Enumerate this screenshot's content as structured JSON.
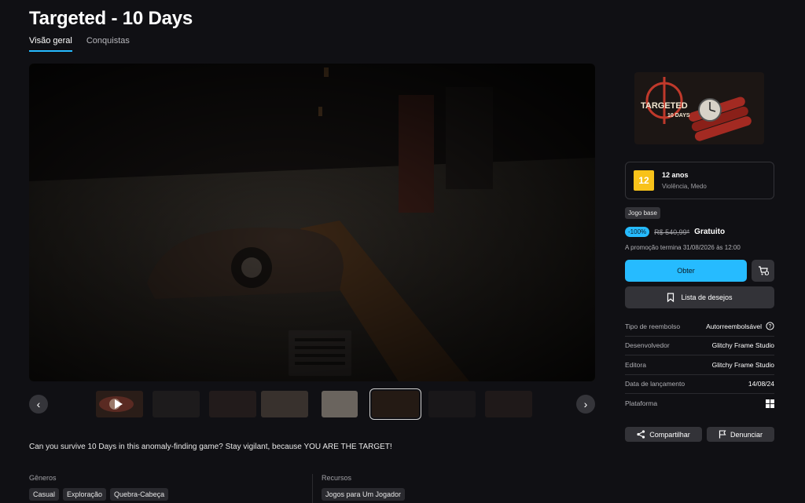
{
  "page": {
    "title": "Targeted - 10 Days"
  },
  "tabs": [
    {
      "label": "Visão geral"
    },
    {
      "label": "Conquistas"
    }
  ],
  "description": "Can you survive 10 Days in this anomaly-finding game? Stay vigilant, because YOU ARE THE TARGET!",
  "genres": {
    "label": "Gêneros",
    "items": [
      "Casual",
      "Exploração",
      "Quebra-Cabeça"
    ]
  },
  "features": {
    "label": "Recursos",
    "items": [
      "Jogos para Um Jogador"
    ]
  },
  "cover": {
    "title_line1": "TARGETED",
    "title_line2": "10 DAYS"
  },
  "rating": {
    "box": "12",
    "age": "12 anos",
    "descriptors": "Violência, Medo"
  },
  "badge": "Jogo base",
  "price": {
    "discount": "-100%",
    "original": "R$ 540,99*",
    "current": "Gratuito",
    "promo_end": "A promoção termina 31/08/2026 às 12:00"
  },
  "buttons": {
    "get": "Obter",
    "wishlist": "Lista de desejos",
    "share": "Compartilhar",
    "report": "Denunciar"
  },
  "info": [
    {
      "key": "Tipo de reembolso",
      "value": "Autorreembolsável"
    },
    {
      "key": "Desenvolvedor",
      "value": "Glitchy Frame Studio"
    },
    {
      "key": "Editora",
      "value": "Glitchy Frame Studio"
    },
    {
      "key": "Data de lançamento",
      "value": "14/08/24"
    },
    {
      "key": "Plataforma",
      "value": ""
    }
  ],
  "carousel": {
    "prev": "‹",
    "next": "›",
    "active_index": 6
  },
  "colors": {
    "accent": "#26bbff",
    "background": "#101014",
    "rating": "#f8c21a"
  }
}
